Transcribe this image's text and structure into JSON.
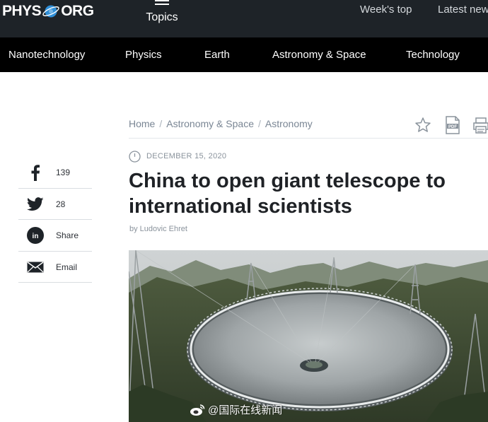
{
  "header": {
    "logo_left": "PHYS",
    "logo_right": "ORG",
    "topics_label": "Topics",
    "links": [
      "Week's top",
      "Latest news"
    ]
  },
  "category_nav": {
    "items": [
      "Nanotechnology",
      "Physics",
      "Earth",
      "Astronomy & Space",
      "Technology"
    ]
  },
  "breadcrumb": {
    "items": [
      "Home",
      "Astronomy & Space",
      "Astronomy"
    ]
  },
  "article": {
    "date": "DECEMBER 15, 2020",
    "title": "China to open giant telescope to international scientists",
    "author": "by Ludovic Ehret"
  },
  "share": {
    "items": [
      {
        "icon": "facebook-icon",
        "label": "139"
      },
      {
        "icon": "twitter-icon",
        "label": "28"
      },
      {
        "icon": "linkedin-icon",
        "label": "Share"
      },
      {
        "icon": "email-icon",
        "label": "Email"
      }
    ]
  },
  "photo": {
    "caption": "@国际在线新闻"
  },
  "colors": {
    "topbar": "#1e2328",
    "catnav": "#000000",
    "logo_accent": "#2f8fd8",
    "title": "#1f2226",
    "muted": "#7a8694"
  }
}
